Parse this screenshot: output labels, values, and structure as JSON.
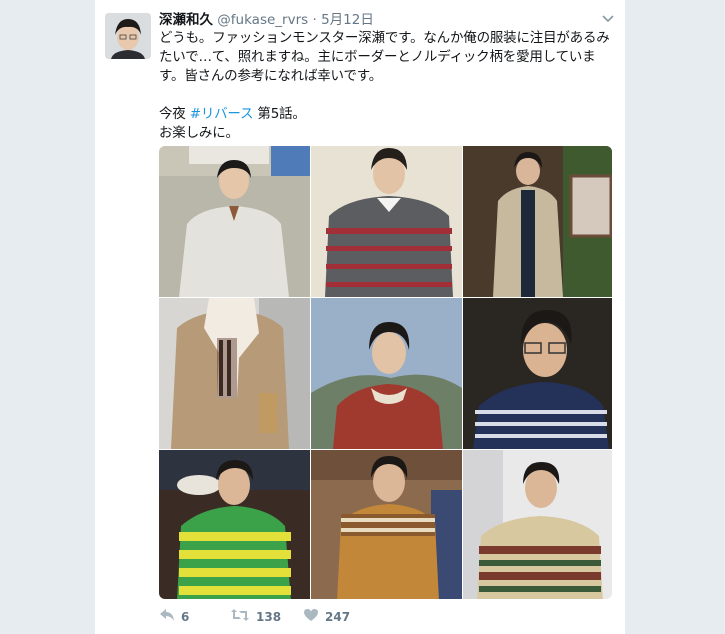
{
  "tweet": {
    "author_name": "深瀬和久",
    "handle": "@fukase_rvrs",
    "separator": "·",
    "time": "5月12日",
    "text_main": "どうも。ファッションモンスター深瀬です。なんか俺の服装に注目があるみたいで…て、照れますね。主にボーダーとノルディック柄を愛用しています。皆さんの参考になれば幸いです。",
    "text_line2_prefix": "今夜 ",
    "hashtag": "#リバース",
    "text_line2_suffix": " 第5話。",
    "text_line3": "お楽しみに。"
  },
  "actions": {
    "replies": "6",
    "retweets": "138",
    "likes": "247"
  },
  "colors": {
    "background": "#e6ecf0",
    "text": "#14171a",
    "muted": "#657786",
    "link": "#1b95e0"
  },
  "icons": [
    "caret-down-icon",
    "reply-icon",
    "retweet-icon",
    "heart-icon"
  ],
  "photos": [
    "work-jacket-photo",
    "gray-striped-sweater-photo",
    "beige-coat-photo",
    "scarf-coat-photo",
    "red-hoodie-photo",
    "navy-striped-shirt-photo",
    "green-striped-sweater-photo",
    "nordic-sweater-photo",
    "fair-isle-sweater-photo"
  ]
}
